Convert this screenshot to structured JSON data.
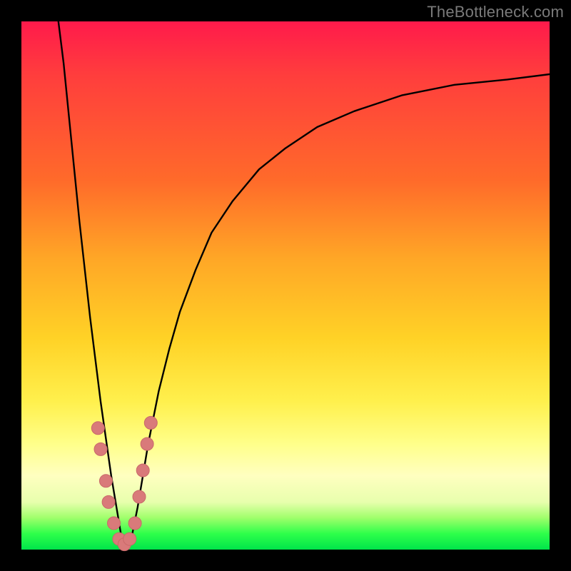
{
  "watermark": "TheBottleneck.com",
  "colors": {
    "frame": "#000000",
    "curve": "#000000",
    "marker_fill": "#d97a7a",
    "marker_stroke": "#c96969",
    "gradient_stops": [
      "#ff1a4b",
      "#ff3d3d",
      "#ff6a2a",
      "#ffa726",
      "#ffd226",
      "#fff04d",
      "#ffff8a",
      "#ffffc0",
      "#e8ffad",
      "#9fff6b",
      "#2eff4a",
      "#00e44a"
    ]
  },
  "chart_data": {
    "type": "line",
    "title": "",
    "xlabel": "",
    "ylabel": "",
    "xlim": [
      0,
      100
    ],
    "ylim": [
      0,
      100
    ],
    "grid": false,
    "legend": false,
    "comment": "V-shaped bottleneck curve. x ≈ relative component score, y ≈ bottleneck %. Minimum near x≈19 at y≈0. Read from pixel positions; original has no tick labels.",
    "series": [
      {
        "name": "bottleneck-curve",
        "x": [
          7,
          8,
          9,
          10,
          11,
          12,
          13,
          14,
          15,
          16,
          17,
          18,
          19,
          20,
          21,
          22,
          23,
          24,
          26,
          28,
          30,
          33,
          36,
          40,
          45,
          50,
          56,
          63,
          72,
          82,
          92,
          100
        ],
        "y": [
          100,
          92,
          82,
          72,
          62,
          53,
          44,
          36,
          28,
          21,
          14,
          8,
          2,
          0,
          3,
          8,
          14,
          20,
          30,
          38,
          45,
          53,
          60,
          66,
          72,
          76,
          80,
          83,
          86,
          88,
          89,
          90
        ]
      }
    ],
    "markers": {
      "name": "sample-points",
      "comment": "Small salmon dots clustered around the curve minimum.",
      "points": [
        {
          "x": 14.5,
          "y": 23
        },
        {
          "x": 15.0,
          "y": 19
        },
        {
          "x": 16.0,
          "y": 13
        },
        {
          "x": 16.5,
          "y": 9
        },
        {
          "x": 17.5,
          "y": 5
        },
        {
          "x": 18.5,
          "y": 2
        },
        {
          "x": 19.5,
          "y": 1
        },
        {
          "x": 20.5,
          "y": 2
        },
        {
          "x": 21.5,
          "y": 5
        },
        {
          "x": 22.3,
          "y": 10
        },
        {
          "x": 23.0,
          "y": 15
        },
        {
          "x": 23.8,
          "y": 20
        },
        {
          "x": 24.5,
          "y": 24
        }
      ]
    }
  }
}
